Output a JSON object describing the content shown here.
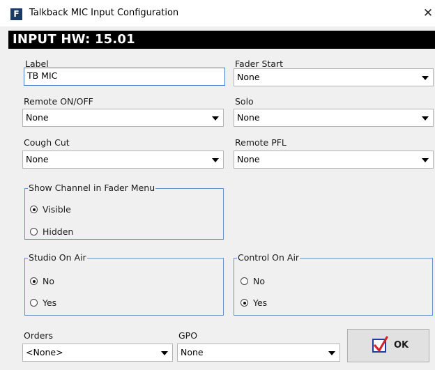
{
  "window": {
    "title": "Talkback MIC Input Configuration",
    "app_icon_letter": "F",
    "close_glyph": "✕"
  },
  "header": {
    "text": "INPUT HW: 15.01"
  },
  "fields": {
    "label": {
      "label": "Label",
      "value": "TB MIC"
    },
    "fader_start": {
      "label": "Fader Start",
      "value": "None"
    },
    "remote_on_off": {
      "label": "Remote ON/OFF",
      "value": "None"
    },
    "solo": {
      "label": "Solo",
      "value": "None"
    },
    "cough_cut": {
      "label": "Cough Cut",
      "value": "None"
    },
    "remote_pfl": {
      "label": "Remote PFL",
      "value": "None"
    },
    "orders": {
      "label": "Orders",
      "value": "<None>"
    },
    "gpo": {
      "label": "GPO",
      "value": "None"
    }
  },
  "groups": {
    "show_channel": {
      "title": "Show Channel in Fader Menu",
      "options": [
        {
          "label": "Visible",
          "selected": true
        },
        {
          "label": "Hidden",
          "selected": false
        }
      ]
    },
    "studio_on_air": {
      "title": "Studio On Air",
      "options": [
        {
          "label": "No",
          "selected": true
        },
        {
          "label": "Yes",
          "selected": false
        }
      ]
    },
    "control_on_air": {
      "title": "Control On Air",
      "options": [
        {
          "label": "No",
          "selected": false
        },
        {
          "label": "Yes",
          "selected": true
        }
      ]
    }
  },
  "buttons": {
    "ok_label": "OK"
  },
  "icons": {
    "app": "app-logo-icon",
    "close": "close-icon",
    "dropdown": "chevron-down-icon",
    "ok": "checkmark-icon"
  },
  "colors": {
    "accent_border": "#3b7fd0",
    "group_border": "#6a90c9",
    "header_bg": "#000000",
    "check_blue": "#1d3ea0",
    "check_red": "#d0262e"
  }
}
